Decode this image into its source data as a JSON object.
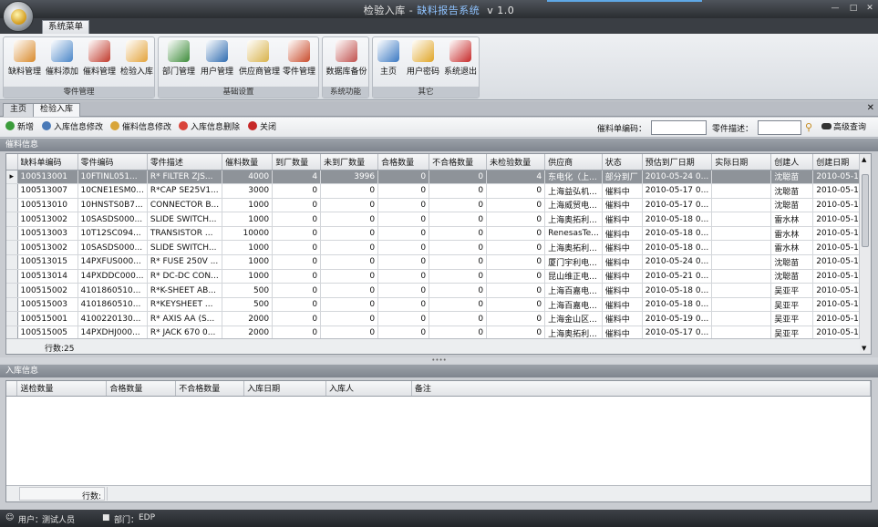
{
  "window": {
    "title": "检验入库",
    "separator": " - ",
    "app_name": "缺料报告系统",
    "version": "v 1.0"
  },
  "ribbon": {
    "tab": "系统菜单",
    "groups": [
      {
        "label": "零件管理",
        "buttons": [
          {
            "label": "缺料管理",
            "icon": "pencil-doc-icon",
            "color": "#d98a2b"
          },
          {
            "label": "催料添加",
            "icon": "folder-add-icon",
            "color": "#4a86c8"
          },
          {
            "label": "催料管理",
            "icon": "book-icon",
            "color": "#c0392b"
          },
          {
            "label": "检验入库",
            "icon": "hand-icon",
            "color": "#e3a33a"
          }
        ]
      },
      {
        "label": "基础设置",
        "buttons": [
          {
            "label": "部门管理",
            "icon": "users-icon",
            "color": "#3d8c3a"
          },
          {
            "label": "用户管理",
            "icon": "user-check-icon",
            "color": "#2e6bb0"
          },
          {
            "label": "供应商管理",
            "icon": "joystick-icon",
            "color": "#d8b24a"
          },
          {
            "label": "零件管理",
            "icon": "parts-box-icon",
            "color": "#c94b2b"
          }
        ]
      },
      {
        "label": "系统功能",
        "buttons": [
          {
            "label": "数据库备份",
            "icon": "database-backup-icon",
            "color": "#c0504d"
          }
        ]
      },
      {
        "label": "其它",
        "buttons": [
          {
            "label": "主页",
            "icon": "monitor-icon",
            "color": "#3a78c2"
          },
          {
            "label": "用户密码",
            "icon": "lock-icon",
            "color": "#e0a526"
          },
          {
            "label": "系统退出",
            "icon": "exit-icon",
            "color": "#c62828"
          }
        ]
      }
    ]
  },
  "doc_tabs": [
    {
      "label": "主页",
      "active": false
    },
    {
      "label": "检验入库",
      "active": true
    }
  ],
  "toolbar": {
    "buttons": [
      {
        "label": "新增",
        "icon": "add-icon",
        "color": "#3b9c3b"
      },
      {
        "label": "入库信息修改",
        "icon": "edit-users-icon",
        "color": "#4a7ab8"
      },
      {
        "label": "催料信息修改",
        "icon": "edit-doc-icon",
        "color": "#d8a53a"
      },
      {
        "label": "入库信息删除",
        "icon": "delete-icon",
        "color": "#d9443a"
      },
      {
        "label": "关闭",
        "icon": "close-icon",
        "color": "#c62828"
      }
    ],
    "order_label": "催料单编码：",
    "part_label": "零件描述：",
    "advanced_label": "高级查询"
  },
  "panel1": {
    "title": "催料信息",
    "row_count_label": "行数:25"
  },
  "grid1": {
    "columns": [
      "缺料单编码",
      "零件编码",
      "零件描述",
      "催料数量",
      "到厂数量",
      "未到厂数量",
      "合格数量",
      "不合格数量",
      "未检验数量",
      "供应商",
      "状态",
      "预估到厂日期",
      "实际日期",
      "创建人",
      "创建日期"
    ],
    "rows": [
      [
        "100513001",
        "10FTINL051...",
        "R* FILTER ZJS...",
        "4000",
        "4",
        "3996",
        "0",
        "0",
        "4",
        "东电化（上...",
        "部分到厂",
        "2010-05-24 0...",
        "",
        "沈聪苗",
        "2010-05-1..."
      ],
      [
        "100513007",
        "10CNE1ESM0...",
        "R*CAP SE25V1...",
        "3000",
        "0",
        "0",
        "0",
        "0",
        "0",
        "上海益弘机...",
        "催料中",
        "2010-05-17 0...",
        "",
        "沈聪苗",
        "2010-05-1..."
      ],
      [
        "100513010",
        "10HNSTS0B7...",
        "CONNECTOR B...",
        "1000",
        "0",
        "0",
        "0",
        "0",
        "0",
        "上海威贸电...",
        "催料中",
        "2010-05-17 0...",
        "",
        "沈聪苗",
        "2010-05-1..."
      ],
      [
        "100513002",
        "10SASDS000...",
        "SLIDE SWITCH...",
        "1000",
        "0",
        "0",
        "0",
        "0",
        "0",
        "上海奥拓利...",
        "催料中",
        "2010-05-18 0...",
        "",
        "雷水林",
        "2010-05-1..."
      ],
      [
        "100513003",
        "10T12SC094...",
        "TRANSISTOR ...",
        "10000",
        "0",
        "0",
        "0",
        "0",
        "0",
        "RenesasTe...",
        "催料中",
        "2010-05-18 0...",
        "",
        "雷水林",
        "2010-05-1..."
      ],
      [
        "100513002",
        "10SASDS000...",
        "SLIDE SWITCH...",
        "1000",
        "0",
        "0",
        "0",
        "0",
        "0",
        "上海奥拓利...",
        "催料中",
        "2010-05-18 0...",
        "",
        "雷水林",
        "2010-05-1..."
      ],
      [
        "100513015",
        "14PXFUS000...",
        "R* FUSE 250V ...",
        "1000",
        "0",
        "0",
        "0",
        "0",
        "0",
        "厦门宇利电...",
        "催料中",
        "2010-05-24 0...",
        "",
        "沈聪苗",
        "2010-05-1..."
      ],
      [
        "100513014",
        "14PXDDC000...",
        "R* DC-DC CON...",
        "1000",
        "0",
        "0",
        "0",
        "0",
        "0",
        "昆山维正电...",
        "催料中",
        "2010-05-21 0...",
        "",
        "沈聪苗",
        "2010-05-1..."
      ],
      [
        "100515002",
        "4101860510...",
        "R*K-SHEET AB...",
        "500",
        "0",
        "0",
        "0",
        "0",
        "0",
        "上海百嘉电...",
        "催料中",
        "2010-05-18 0...",
        "",
        "吴亚平",
        "2010-05-1..."
      ],
      [
        "100515003",
        "4101860510...",
        "R*KEYSHEET ...",
        "500",
        "0",
        "0",
        "0",
        "0",
        "0",
        "上海百嘉电...",
        "催料中",
        "2010-05-18 0...",
        "",
        "吴亚平",
        "2010-05-1..."
      ],
      [
        "100515001",
        "4100220130...",
        "R* AXIS AA (S...",
        "2000",
        "0",
        "0",
        "0",
        "0",
        "0",
        "上海金山区...",
        "催料中",
        "2010-05-19 0...",
        "",
        "吴亚平",
        "2010-05-1..."
      ],
      [
        "100515005",
        "14PXDHJ000...",
        "R* JACK 670 0...",
        "2000",
        "0",
        "0",
        "0",
        "0",
        "0",
        "上海奥拓利...",
        "催料中",
        "2010-05-17 0...",
        "",
        "吴亚平",
        "2010-05-1..."
      ]
    ]
  },
  "panel2": {
    "title": "入库信息",
    "row_count_label": "行数:"
  },
  "grid2": {
    "columns": [
      "送检数量",
      "合格数量",
      "不合格数量",
      "入库日期",
      "入库人",
      "备注"
    ]
  },
  "status": {
    "user_label": "用户：",
    "user": "测试人员",
    "dept_label": "部门：",
    "dept": "EDP"
  }
}
